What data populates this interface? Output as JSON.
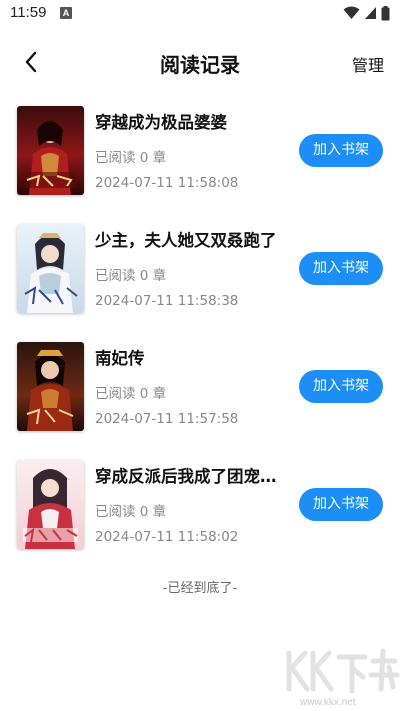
{
  "status_bar": {
    "time": "11:59",
    "notification_badge": "A",
    "icons": [
      "wifi-icon",
      "signal-icon",
      "battery-icon"
    ]
  },
  "header": {
    "title": "阅读记录",
    "manage_label": "管理",
    "back_icon": "chevron-left-icon"
  },
  "books": [
    {
      "title": "穿越成为极品婆婆",
      "progress": "已阅读 0 章",
      "time": "2024-07-11 11:58:08",
      "button": "加入书架"
    },
    {
      "title": "少主，夫人她又双叒跑了",
      "progress": "已阅读 0 章",
      "time": "2024-07-11 11:58:38",
      "button": "加入书架"
    },
    {
      "title": "南妃传",
      "progress": "已阅读 0 章",
      "time": "2024-07-11 11:57:58",
      "button": "加入书架"
    },
    {
      "title": "穿成反派后我成了团宠…",
      "progress": "已阅读 0 章",
      "time": "2024-07-11 11:58:02",
      "button": "加入书架"
    }
  ],
  "footer": {
    "end_text": "-已经到底了-"
  },
  "watermark": {
    "logo_text": "KK下载",
    "url": "www.kkx.net"
  },
  "colors": {
    "accent": "#1c8ef5",
    "title_text": "#111111",
    "secondary_text": "#888888"
  }
}
